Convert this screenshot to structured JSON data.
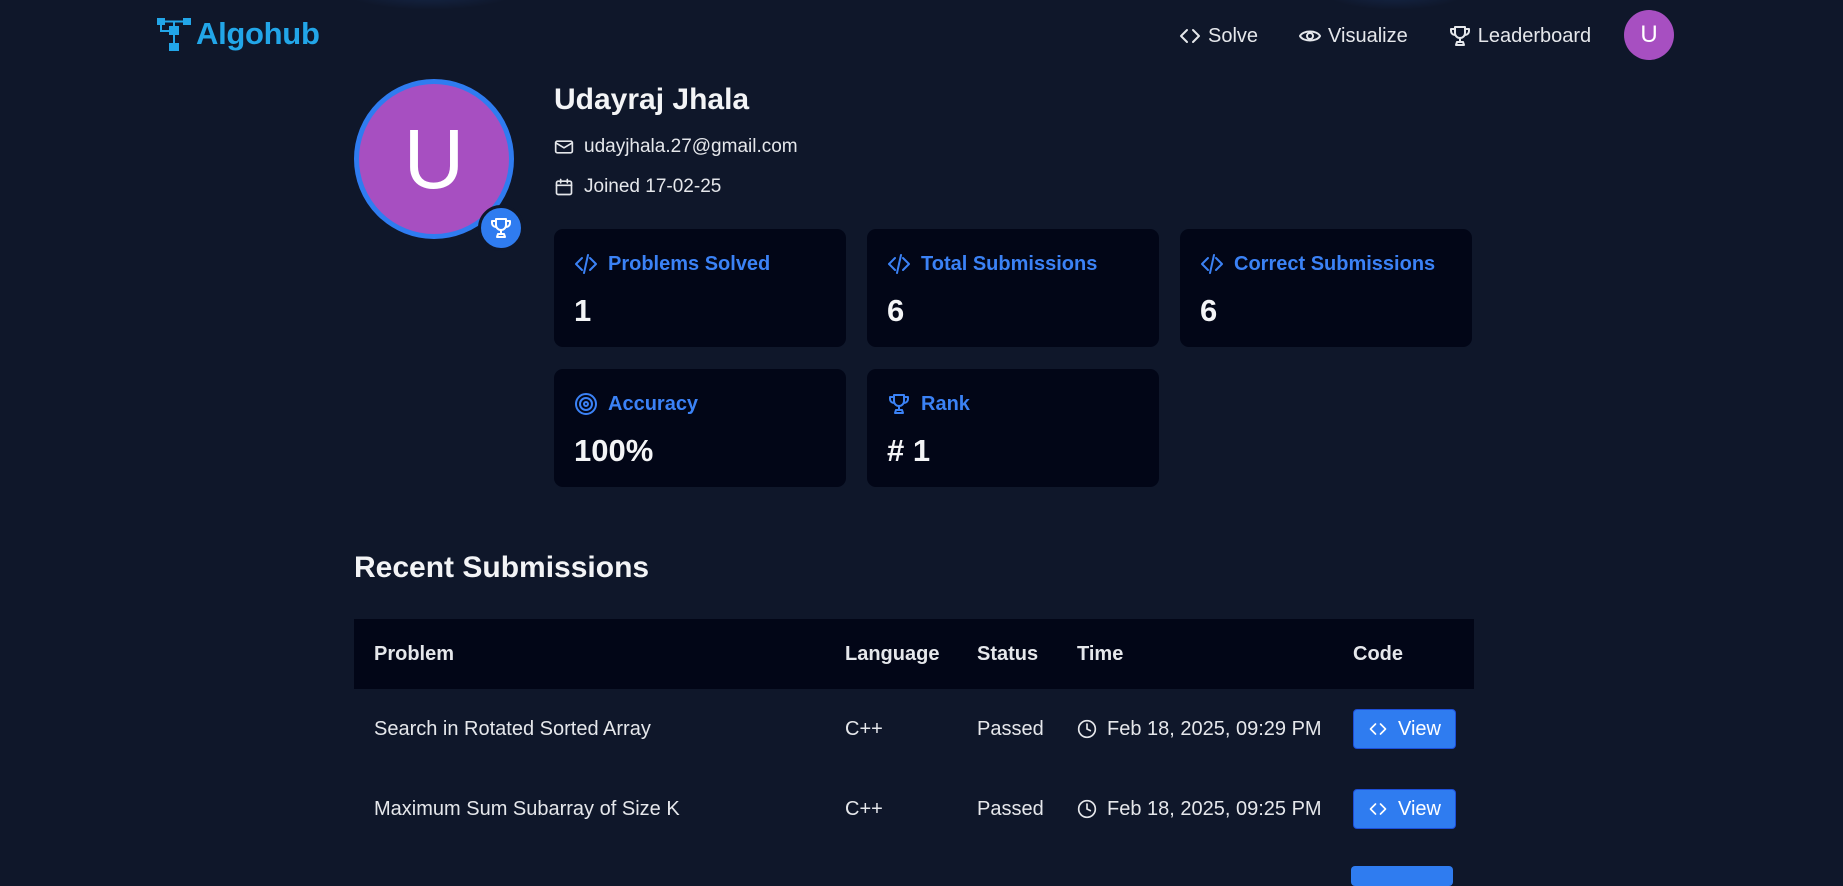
{
  "brand": {
    "name": "Algohub"
  },
  "nav": {
    "links": [
      {
        "label": "Solve",
        "icon": "code-icon"
      },
      {
        "label": "Visualize",
        "icon": "eye-icon"
      },
      {
        "label": "Leaderboard",
        "icon": "trophy-icon"
      }
    ],
    "avatar_initial": "U"
  },
  "profile": {
    "initial": "U",
    "name": "Udayraj Jhala",
    "email": "udayjhala.27@gmail.com",
    "joined": "Joined 17-02-25",
    "avatar_color": "#a74fc1",
    "accent_color": "#2f7cf0"
  },
  "stats": [
    {
      "label": "Problems Solved",
      "value": "1",
      "icon": "code-icon"
    },
    {
      "label": "Total Submissions",
      "value": "6",
      "icon": "code-icon"
    },
    {
      "label": "Correct Submissions",
      "value": "6",
      "icon": "code-icon"
    },
    {
      "label": "Accuracy",
      "value": "100%",
      "icon": "target-icon"
    },
    {
      "label": "Rank",
      "value": "# 1",
      "icon": "trophy-icon"
    }
  ],
  "recent": {
    "title": "Recent Submissions",
    "columns": [
      "Problem",
      "Language",
      "Status",
      "Time",
      "Code"
    ],
    "rows": [
      {
        "problem": "Search in Rotated Sorted Array",
        "language": "C++",
        "status": "Passed",
        "time": "Feb 18, 2025, 09:29 PM",
        "action": "View"
      },
      {
        "problem": "Maximum Sum Subarray of Size K",
        "language": "C++",
        "status": "Passed",
        "time": "Feb 18, 2025, 09:25 PM",
        "action": "View"
      }
    ]
  },
  "colors": {
    "background": "#0f172a",
    "card": "#020617",
    "brand": "#22a6e8",
    "accent": "#3b82f6",
    "passed": "#22c55e"
  }
}
